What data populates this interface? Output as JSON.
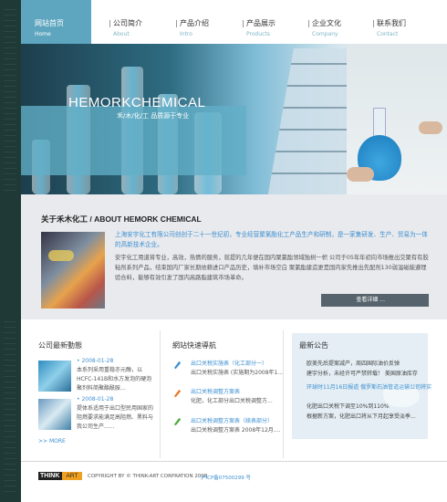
{
  "nav": {
    "items": [
      {
        "zh": "网站首页",
        "en": "Home"
      },
      {
        "zh": "公司简介",
        "en": "About"
      },
      {
        "zh": "产品介绍",
        "en": "Intro"
      },
      {
        "zh": "产品展示",
        "en": "Products"
      },
      {
        "zh": "企业文化",
        "en": "Company"
      },
      {
        "zh": "联系我们",
        "en": "Contact"
      }
    ]
  },
  "banner": {
    "title": "HEMORKCHEMICAL",
    "subtitle": "禾/木/化/工  品质源于专业"
  },
  "about": {
    "title": "关于禾木化工 / ABOUT HEMORK CHEMICAL",
    "lead": "上海安宇化工有限公司创创于二十一世纪初，专业经营聚氯酯化工产品生产和研制，是一家集研发、生产、贸易为一体的高新技术企业。",
    "body": "安宇化工用道将专业，高效，热情的服务，就提的几年便在国内聚氯酯领域独树一帜 公司于05年年初向市场推出交聚有有胶粘剂系列产品，结束国内厂家长期依赖进口产品历史，填补市场空白 聚氯酯建造更是国内家先推出先配剂130弱温磁能遵理验合料，能够有效引发了国内高路脂建筑市场革命。",
    "more_label": "查看详细 ..."
  },
  "news": {
    "title": "公司最新動態",
    "items": [
      {
        "date": "• 2008-01-28",
        "text": "本系列采用重稳亦元酶，以HCFC-141B和水方发泡的硬泡聚剂料简聚酯酰胺..."
      },
      {
        "date": "• 2008-01-28",
        "text": "提体系适用于出口型民用国家的阻燃要求能满足高阻燃、黑料与我公司生产......"
      }
    ],
    "more_label": ">> MORE"
  },
  "links": {
    "title": "網站快速導航",
    "items": [
      {
        "category": "出口关税实施表（化工部分一）",
        "text": "出口关税实施表 (实施期为2008年1..."
      },
      {
        "category": "出口关税调整方案表",
        "text": "化肥，化工部分出口关税调整方..."
      },
      {
        "category": "出口关税调整方案表（续表部分）",
        "text": "出口关税调整方案表 2008年12月...."
      }
    ]
  },
  "notice": {
    "title": "最新公告",
    "lines": [
      "欧美先后提案减产，周四国际油价反弹",
      "建宇分析，未经许可严禁转载！  美国原油库存",
      "环球时11月16日报道 俄罗斯石油管道运输公司将实",
      "化肥出口关税下调至10%到110%",
      "根据新方案，化肥出口将从下月起享受淡季..."
    ]
  },
  "footer": {
    "logo_main": "THINK",
    "logo_accent": "ART",
    "copyright": "COPYRIGHT BY © THINK-ART CORPRATION 2008",
    "icp": "沪ICP备07500299 号"
  },
  "colors": {
    "accent_blue": "#5ea6bf",
    "link_blue": "#3c8fd0",
    "dark_strip": "#1f3a36",
    "about_bg": "#e9eaed"
  }
}
